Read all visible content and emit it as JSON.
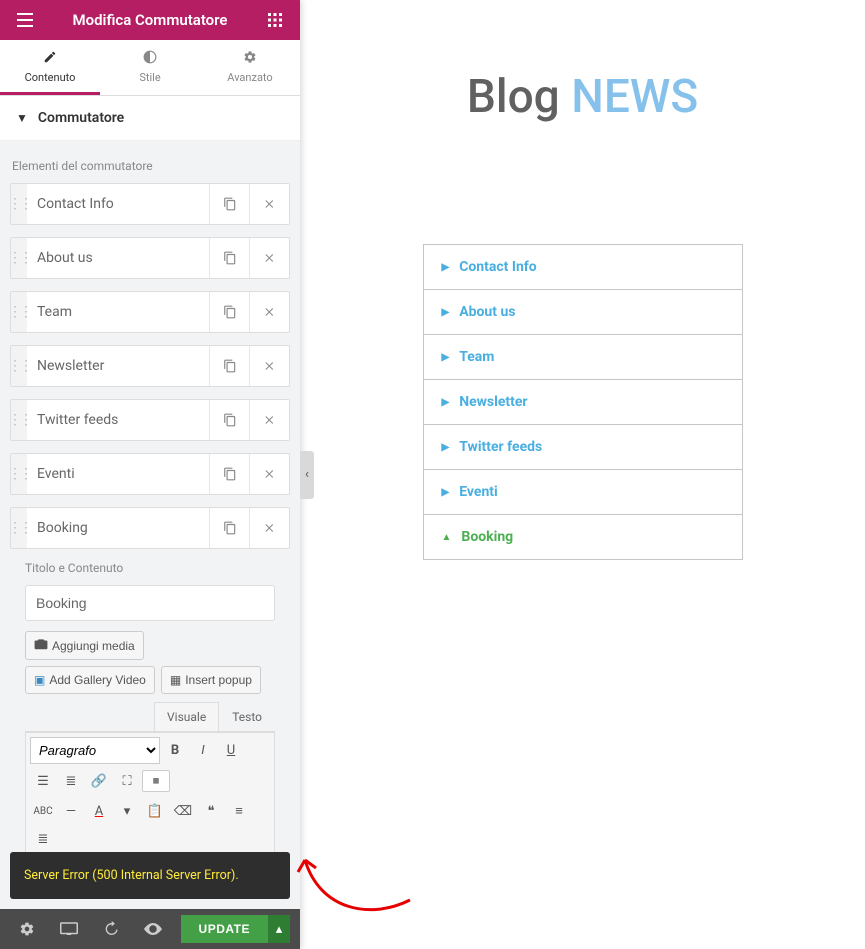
{
  "header": {
    "title": "Modifica Commutatore"
  },
  "tabs": {
    "content": "Contenuto",
    "style": "Stile",
    "advanced": "Avanzato"
  },
  "section": {
    "title": "Commutatore"
  },
  "elements_label": "Elementi del commutatore",
  "items": [
    {
      "label": "Contact Info"
    },
    {
      "label": "About us"
    },
    {
      "label": "Team"
    },
    {
      "label": "Newsletter"
    },
    {
      "label": "Twitter feeds"
    },
    {
      "label": "Eventi"
    },
    {
      "label": "Booking"
    }
  ],
  "title_section_label": "Titolo e Contenuto",
  "title_value": "Booking",
  "media": {
    "add": "Aggiungi media",
    "gallery": "Add Gallery Video",
    "popup": "Insert popup"
  },
  "editor_tabs": {
    "visual": "Visuale",
    "text": "Testo"
  },
  "format_option": "Paragrafo",
  "error": "Server Error (500 Internal Server Error).",
  "update_btn": "UPDATE",
  "preview": {
    "hero_a": "Blog ",
    "hero_b": "NEWS",
    "accordion": [
      "Contact Info",
      "About us",
      "Team",
      "Newsletter",
      "Twitter feeds",
      "Eventi",
      "Booking"
    ]
  }
}
